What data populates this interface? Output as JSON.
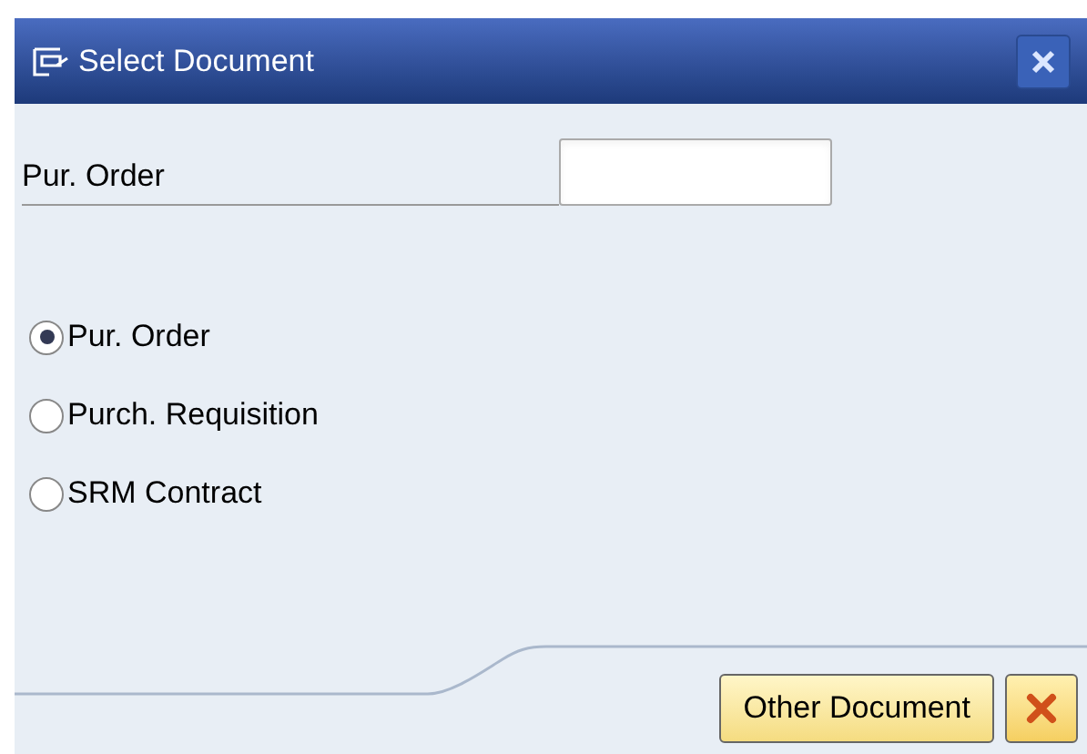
{
  "window": {
    "title": "Select Document"
  },
  "field": {
    "label": "Pur. Order"
  },
  "options": [
    {
      "label": "Pur. Order",
      "selected": true
    },
    {
      "label": "Purch. Requisition",
      "selected": false
    },
    {
      "label": "SRM Contract",
      "selected": false
    }
  ],
  "buttons": [
    {
      "label": "Other Document"
    }
  ]
}
